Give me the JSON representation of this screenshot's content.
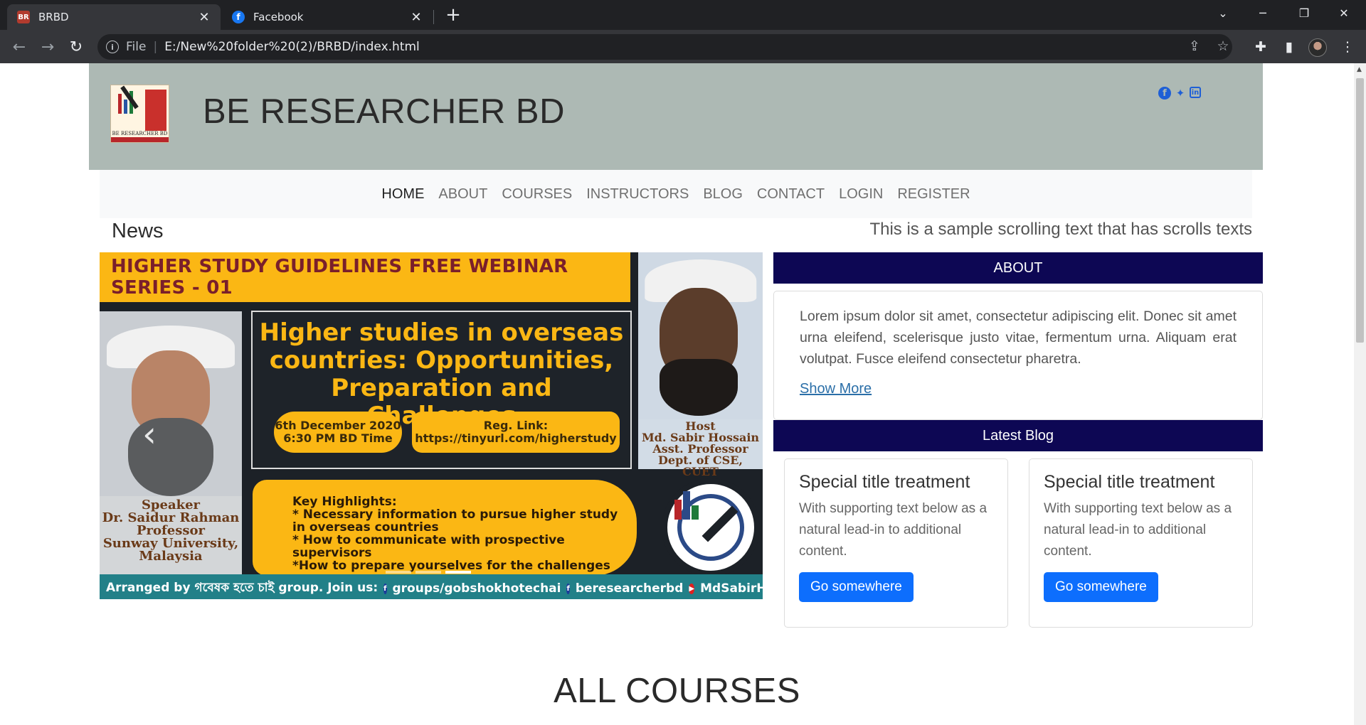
{
  "browser": {
    "tabs": [
      {
        "title": "BRBD",
        "favicon": "brbd-favicon",
        "active": true
      },
      {
        "title": "Facebook",
        "favicon": "facebook-favicon",
        "active": false
      }
    ],
    "close_glyph": "✕",
    "new_tab_glyph": "+",
    "address": {
      "scheme": "File",
      "url": "E:/New%20folder%20(2)/BRBD/index.html"
    }
  },
  "site": {
    "brand": "BE RESEARCHER BD",
    "logo_caption": "BE RESEARCHER BD",
    "socials": [
      {
        "name": "facebook",
        "glyph": "f"
      },
      {
        "name": "twitter",
        "glyph": "🐦"
      },
      {
        "name": "linkedin",
        "glyph": "in"
      }
    ],
    "nav": [
      {
        "label": "HOME",
        "active": true
      },
      {
        "label": "ABOUT",
        "active": false
      },
      {
        "label": "COURSES",
        "active": false
      },
      {
        "label": "INSTRUCTORS",
        "active": false
      },
      {
        "label": "BLOG",
        "active": false
      },
      {
        "label": "CONTACT",
        "active": false
      },
      {
        "label": "LOGIN",
        "active": false
      },
      {
        "label": "REGISTER",
        "active": false
      }
    ],
    "news_label": "News",
    "marquee_text": "This is a sample scrolling text that has scrolls texts"
  },
  "banner": {
    "title": "HIGHER STUDY GUIDELINES FREE WEBINAR SERIES - 01",
    "headline": [
      "Higher studies in overseas",
      "countries: Opportunities,",
      "Preparation and Challenges"
    ],
    "date": [
      "6th December 2020",
      "6:30 PM BD Time"
    ],
    "reg": [
      "Reg. Link:",
      "https://tinyurl.com/higherstudy"
    ],
    "speaker": [
      "Speaker",
      "Dr. Saidur Rahman",
      "Professor",
      "Sunway University,",
      "Malaysia"
    ],
    "host": [
      "Host",
      "Md. Sabir Hossain",
      "Asst. Professor",
      "Dept. of CSE, CUET"
    ],
    "highlights": [
      "Key Highlights:",
      "* Necessary information to pursue higher study",
      "in overseas countries",
      "* How to communicate with prospective supervisors",
      "*How to prepare yourselves for the challenges"
    ],
    "footer": {
      "arranged": "Arranged by গবেষক হতে চাই group. Join us:",
      "links": [
        {
          "icon": "facebook-icon",
          "text": "groups/gobshokhotechai"
        },
        {
          "icon": "facebook-icon",
          "text": "beresearcherbd"
        },
        {
          "icon": "youtube-icon",
          "text": "MdSabirHossain"
        }
      ]
    },
    "prev_glyph": "‹",
    "next_glyph": "›",
    "active_slide": 3,
    "slide_count": 3
  },
  "about": {
    "heading": "ABOUT",
    "text": "Lorem ipsum dolor sit amet, consectetur adipiscing elit. Donec sit amet urna eleifend, scelerisque justo vitae, fermentum urna. Aliquam erat volutpat. Fusce eleifend consectetur pharetra.",
    "link": "Show More"
  },
  "blog": {
    "heading": "Latest Blog",
    "cards": [
      {
        "title": "Special title treatment",
        "text": "With supporting text below as a natural lead-in to additional content.",
        "button": "Go somewhere"
      },
      {
        "title": "Special title treatment",
        "text": "With supporting text below as a natural lead-in to additional content.",
        "button": "Go somewhere"
      }
    ]
  },
  "courses_heading": "ALL COURSES",
  "colors": {
    "header_bg": "#adb9b4",
    "section_head_bg": "#0d0754",
    "button_primary": "#0d6efd",
    "banner_yellow": "#fbb714"
  }
}
